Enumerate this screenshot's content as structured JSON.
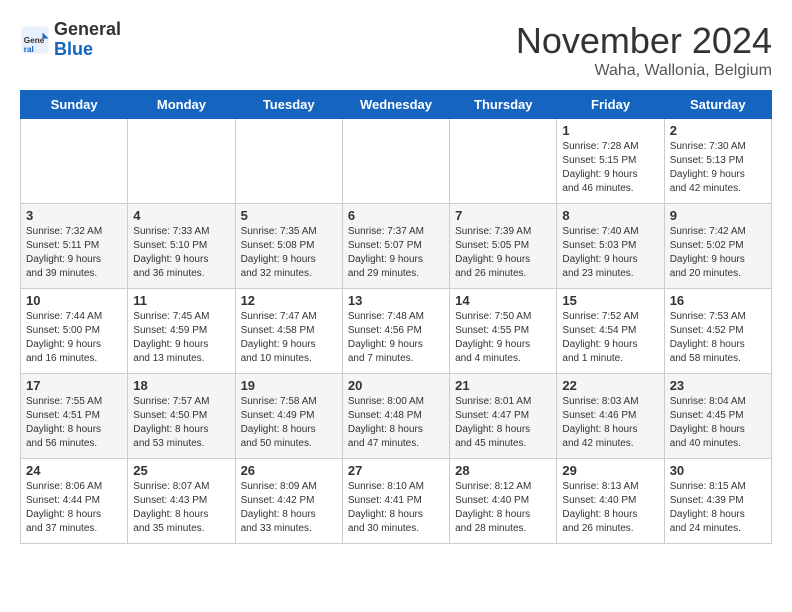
{
  "logo": {
    "general": "General",
    "blue": "Blue"
  },
  "title": "November 2024",
  "subtitle": "Waha, Wallonia, Belgium",
  "days_header": [
    "Sunday",
    "Monday",
    "Tuesday",
    "Wednesday",
    "Thursday",
    "Friday",
    "Saturday"
  ],
  "weeks": [
    [
      {
        "day": "",
        "info": ""
      },
      {
        "day": "",
        "info": ""
      },
      {
        "day": "",
        "info": ""
      },
      {
        "day": "",
        "info": ""
      },
      {
        "day": "",
        "info": ""
      },
      {
        "day": "1",
        "info": "Sunrise: 7:28 AM\nSunset: 5:15 PM\nDaylight: 9 hours\nand 46 minutes."
      },
      {
        "day": "2",
        "info": "Sunrise: 7:30 AM\nSunset: 5:13 PM\nDaylight: 9 hours\nand 42 minutes."
      }
    ],
    [
      {
        "day": "3",
        "info": "Sunrise: 7:32 AM\nSunset: 5:11 PM\nDaylight: 9 hours\nand 39 minutes."
      },
      {
        "day": "4",
        "info": "Sunrise: 7:33 AM\nSunset: 5:10 PM\nDaylight: 9 hours\nand 36 minutes."
      },
      {
        "day": "5",
        "info": "Sunrise: 7:35 AM\nSunset: 5:08 PM\nDaylight: 9 hours\nand 32 minutes."
      },
      {
        "day": "6",
        "info": "Sunrise: 7:37 AM\nSunset: 5:07 PM\nDaylight: 9 hours\nand 29 minutes."
      },
      {
        "day": "7",
        "info": "Sunrise: 7:39 AM\nSunset: 5:05 PM\nDaylight: 9 hours\nand 26 minutes."
      },
      {
        "day": "8",
        "info": "Sunrise: 7:40 AM\nSunset: 5:03 PM\nDaylight: 9 hours\nand 23 minutes."
      },
      {
        "day": "9",
        "info": "Sunrise: 7:42 AM\nSunset: 5:02 PM\nDaylight: 9 hours\nand 20 minutes."
      }
    ],
    [
      {
        "day": "10",
        "info": "Sunrise: 7:44 AM\nSunset: 5:00 PM\nDaylight: 9 hours\nand 16 minutes."
      },
      {
        "day": "11",
        "info": "Sunrise: 7:45 AM\nSunset: 4:59 PM\nDaylight: 9 hours\nand 13 minutes."
      },
      {
        "day": "12",
        "info": "Sunrise: 7:47 AM\nSunset: 4:58 PM\nDaylight: 9 hours\nand 10 minutes."
      },
      {
        "day": "13",
        "info": "Sunrise: 7:48 AM\nSunset: 4:56 PM\nDaylight: 9 hours\nand 7 minutes."
      },
      {
        "day": "14",
        "info": "Sunrise: 7:50 AM\nSunset: 4:55 PM\nDaylight: 9 hours\nand 4 minutes."
      },
      {
        "day": "15",
        "info": "Sunrise: 7:52 AM\nSunset: 4:54 PM\nDaylight: 9 hours\nand 1 minute."
      },
      {
        "day": "16",
        "info": "Sunrise: 7:53 AM\nSunset: 4:52 PM\nDaylight: 8 hours\nand 58 minutes."
      }
    ],
    [
      {
        "day": "17",
        "info": "Sunrise: 7:55 AM\nSunset: 4:51 PM\nDaylight: 8 hours\nand 56 minutes."
      },
      {
        "day": "18",
        "info": "Sunrise: 7:57 AM\nSunset: 4:50 PM\nDaylight: 8 hours\nand 53 minutes."
      },
      {
        "day": "19",
        "info": "Sunrise: 7:58 AM\nSunset: 4:49 PM\nDaylight: 8 hours\nand 50 minutes."
      },
      {
        "day": "20",
        "info": "Sunrise: 8:00 AM\nSunset: 4:48 PM\nDaylight: 8 hours\nand 47 minutes."
      },
      {
        "day": "21",
        "info": "Sunrise: 8:01 AM\nSunset: 4:47 PM\nDaylight: 8 hours\nand 45 minutes."
      },
      {
        "day": "22",
        "info": "Sunrise: 8:03 AM\nSunset: 4:46 PM\nDaylight: 8 hours\nand 42 minutes."
      },
      {
        "day": "23",
        "info": "Sunrise: 8:04 AM\nSunset: 4:45 PM\nDaylight: 8 hours\nand 40 minutes."
      }
    ],
    [
      {
        "day": "24",
        "info": "Sunrise: 8:06 AM\nSunset: 4:44 PM\nDaylight: 8 hours\nand 37 minutes."
      },
      {
        "day": "25",
        "info": "Sunrise: 8:07 AM\nSunset: 4:43 PM\nDaylight: 8 hours\nand 35 minutes."
      },
      {
        "day": "26",
        "info": "Sunrise: 8:09 AM\nSunset: 4:42 PM\nDaylight: 8 hours\nand 33 minutes."
      },
      {
        "day": "27",
        "info": "Sunrise: 8:10 AM\nSunset: 4:41 PM\nDaylight: 8 hours\nand 30 minutes."
      },
      {
        "day": "28",
        "info": "Sunrise: 8:12 AM\nSunset: 4:40 PM\nDaylight: 8 hours\nand 28 minutes."
      },
      {
        "day": "29",
        "info": "Sunrise: 8:13 AM\nSunset: 4:40 PM\nDaylight: 8 hours\nand 26 minutes."
      },
      {
        "day": "30",
        "info": "Sunrise: 8:15 AM\nSunset: 4:39 PM\nDaylight: 8 hours\nand 24 minutes."
      }
    ]
  ]
}
